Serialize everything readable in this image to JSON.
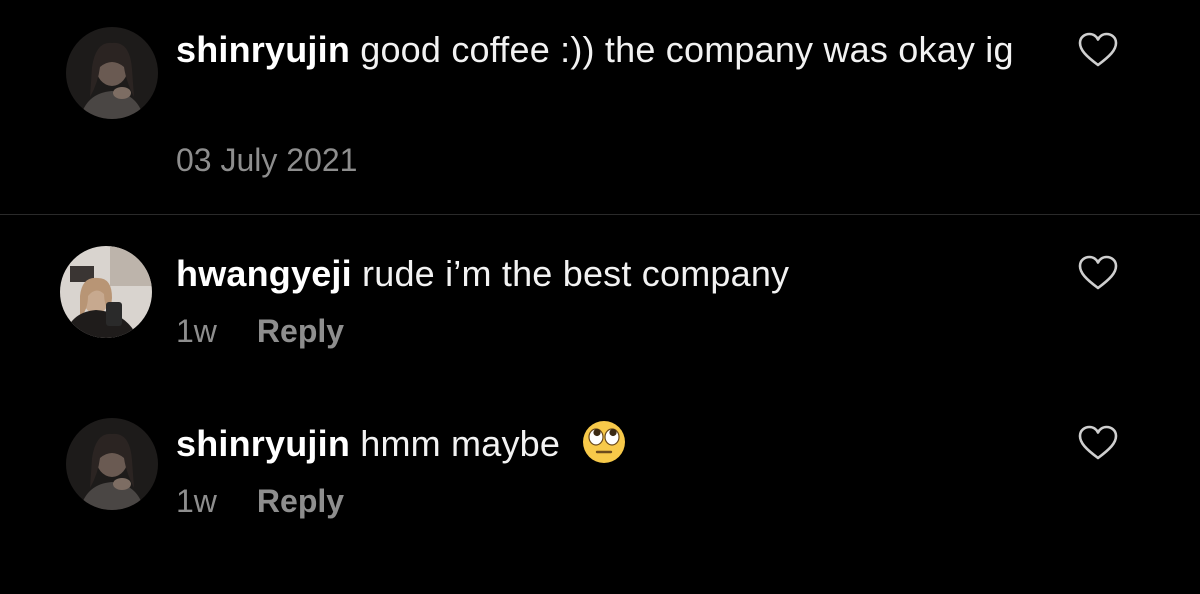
{
  "post": {
    "username": "shinryujin",
    "text": "good coffee :)) the company was okay ig",
    "date": "03 July 2021"
  },
  "comments": [
    {
      "username": "hwangyeji",
      "text": "rude i’m the best company",
      "time": "1w",
      "reply_label": "Reply"
    },
    {
      "username": "shinryujin",
      "text": "hmm maybe",
      "emoji": "face-with-rolling-eyes",
      "time": "1w",
      "reply_label": "Reply"
    }
  ],
  "icons": {
    "like": "heart-outline-icon"
  },
  "colors": {
    "background": "#000000",
    "text": "#ffffff",
    "secondary_text": "#8e8e8e",
    "divider": "#2a2a2a"
  }
}
